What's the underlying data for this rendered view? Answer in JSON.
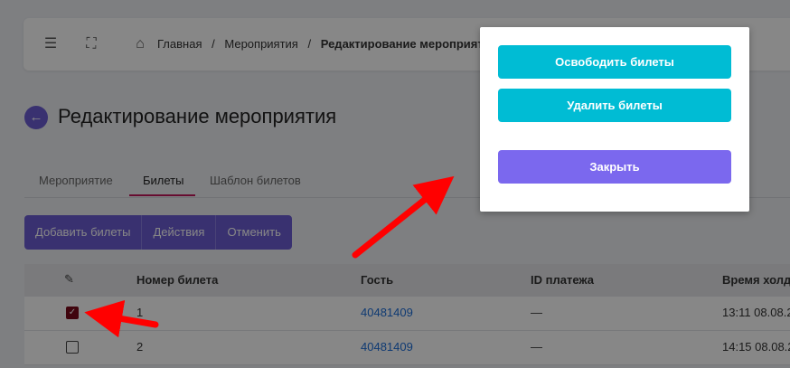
{
  "header": {
    "menu_icon": "hamburger-icon",
    "fullscreen_icon": "fullscreen-icon",
    "home_icon": "home-icon",
    "breadcrumbs": [
      "Главная",
      "Мероприятия",
      "Редактирование мероприятия"
    ],
    "separator": "/"
  },
  "page": {
    "back_icon": "arrow-left-icon",
    "title": "Редактирование мероприятия"
  },
  "tabs": [
    {
      "label": "Мероприятие"
    },
    {
      "label": "Билеты"
    },
    {
      "label": "Шаблон билетов"
    }
  ],
  "actions": {
    "add": "Добавить билеты",
    "actions": "Действия",
    "cancel": "Отменить"
  },
  "table": {
    "headers": [
      "Номер билета",
      "Гость",
      "ID платежа",
      "Время холд"
    ],
    "edit_icon": "edit-icon",
    "rows": [
      {
        "checked": true,
        "number": "1",
        "guest": "40481409",
        "payment_id": "—",
        "hold_time": "13:11 08.08.2"
      },
      {
        "checked": false,
        "number": "2",
        "guest": "40481409",
        "payment_id": "—",
        "hold_time": "14:15 08.08.2"
      }
    ]
  },
  "modal": {
    "release": "Освободить билеты",
    "delete": "Удалить билеты",
    "close": "Закрыть"
  },
  "colors": {
    "primary": "#6c5dd3",
    "teal": "#00bcd4",
    "purple": "#7b68ee",
    "arrow": "#ff0000",
    "link": "#1e6fd9"
  }
}
